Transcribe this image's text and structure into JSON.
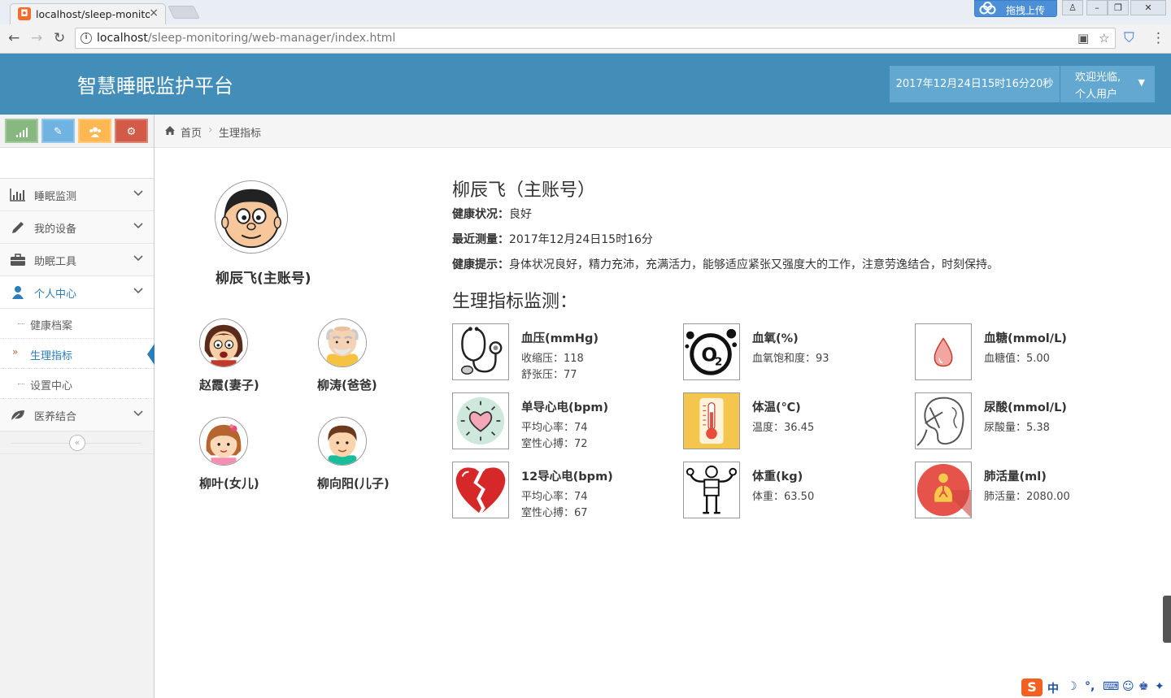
{
  "browser": {
    "tab_title": "localhost/sleep-monito",
    "tab_close": "×",
    "upload_label": "拖拽上传",
    "url_host": "localhost",
    "url_path": "/sleep-monitoring/web-manager/index.html"
  },
  "header": {
    "title": "智慧睡眠监护平台",
    "datetime": "2017年12月24日15时16分20秒",
    "welcome": "欢迎光临,",
    "user": "个人用户"
  },
  "breadcrumb": {
    "home": "首页",
    "current": "生理指标"
  },
  "sidebar": {
    "menu": [
      {
        "label": "睡眠监测",
        "icon": "bar-chart-icon"
      },
      {
        "label": "我的设备",
        "icon": "pencil-icon"
      },
      {
        "label": "助眠工具",
        "icon": "briefcase-icon"
      },
      {
        "label": "个人中心",
        "icon": "user-icon"
      },
      {
        "label": "医养结合",
        "icon": "leaf-icon"
      }
    ],
    "submenu": [
      "健康档案",
      "生理指标",
      "设置中心"
    ]
  },
  "family": {
    "main": "柳辰飞(主账号)",
    "members": [
      "赵霞(妻子)",
      "柳涛(爸爸)",
      "柳叶(女儿)",
      "柳向阳(儿子)"
    ]
  },
  "profile": {
    "name": "柳辰飞（主账号）",
    "status_label": "健康状况：",
    "status_value": "良好",
    "last_label": "最近测量：",
    "last_value": "2017年12月24日15时16分",
    "tip_label": "健康提示：",
    "tip_value": "身体状况良好，精力充沛，充满活力，能够适应紧张又强度大的工作，注意劳逸结合，时刻保持。"
  },
  "section_title": "生理指标监测：",
  "metrics": [
    {
      "title": "血压(mmHg)",
      "l1": "收缩压：118",
      "l2": "舒张压：77",
      "icon": "stethoscope-icon"
    },
    {
      "title": "血氧(%)",
      "l1": "血氧饱和度：93",
      "l2": "",
      "icon": "oxygen-icon"
    },
    {
      "title": "血糖(mmol/L)",
      "l1": "血糖值：5.00",
      "l2": "",
      "icon": "blood-drop-icon"
    },
    {
      "title": "单导心电(bpm)",
      "l1": "平均心率：74",
      "l2": "室性心搏：72",
      "icon": "heart-icon"
    },
    {
      "title": "体温(℃)",
      "l1": "温度：36.45",
      "l2": "",
      "icon": "thermometer-icon"
    },
    {
      "title": "尿酸(mmol/L)",
      "l1": "尿酸量：5.38",
      "l2": "",
      "icon": "kidney-icon"
    },
    {
      "title": "12导心电(bpm)",
      "l1": "平均心率：74",
      "l2": "室性心搏：67",
      "icon": "broken-heart-icon"
    },
    {
      "title": "体重(kg)",
      "l1": "体重：63.50",
      "l2": "",
      "icon": "body-weight-icon"
    },
    {
      "title": "肺活量(ml)",
      "l1": "肺活量：2080.00",
      "l2": "",
      "icon": "lungs-icon"
    }
  ],
  "ime": {
    "mode": "中"
  }
}
